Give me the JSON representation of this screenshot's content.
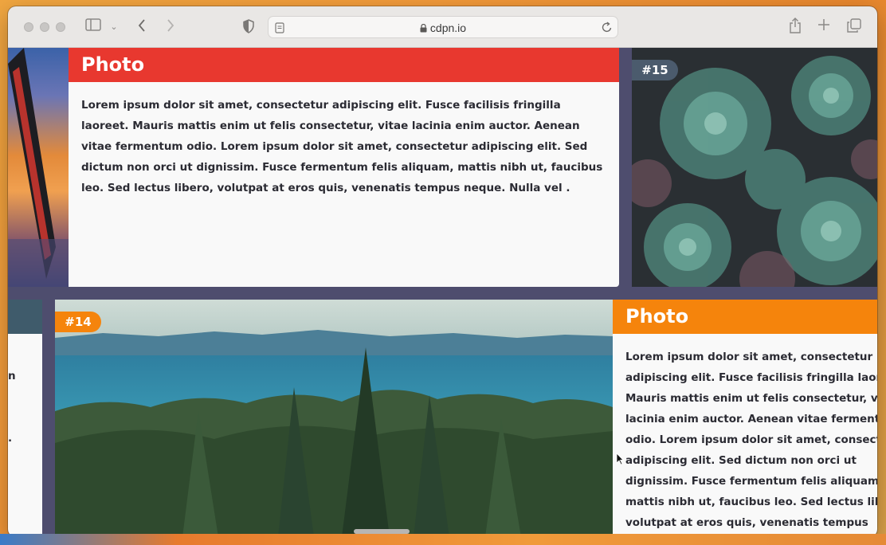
{
  "browser": {
    "address": "cdpn.io",
    "icons": {
      "sidebar": "sidebar-icon",
      "back": "chevron-left-icon",
      "forward": "chevron-right-icon",
      "shield": "shield-icon",
      "page": "page-icon",
      "lock": "lock-icon",
      "reload": "reload-icon",
      "share": "share-icon",
      "new_tab": "plus-icon",
      "tabs": "tabs-overview-icon"
    }
  },
  "cards": [
    {
      "title": "Photo",
      "header_color": "#e8382f",
      "text": "Lorem ipsum dolor sit amet, consectetur adipiscing elit. Fusce facilisis fringilla laoreet. Mauris mattis enim ut felis consectetur, vitae lacinia enim auctor. Aenean vitae fermentum odio. Lorem ipsum dolor sit amet, consectetur adipiscing elit. Sed dictum non orci ut dignissim. Fusce fermentum felis aliquam, mattis nibh ut, faucibus leo. Sed lectus libero, volutpat at eros quis, venenatis tempus neque. Nulla vel ."
    },
    {
      "title": "Photo",
      "header_color": "#f5840c",
      "text": "Lorem ipsum dolor sit amet, consectetur adipiscing elit. Fusce facilisis fringilla laoreet. Mauris mattis enim ut felis consectetur, vitae lacinia enim auctor. Aenean vitae fermentum odio. Lorem ipsum dolor sit amet, consectetur adipiscing elit. Sed dictum non orci ut dignissim. Fusce fermentum felis aliquam, mattis nibh ut, faucibus leo. Sed lectus libero, volutpat at eros quis, venenatis tempus neque. Nulla vel ."
    }
  ],
  "tags": {
    "t15": {
      "label": "#15",
      "color": "#4b5b6d"
    },
    "t14": {
      "label": "#14",
      "color": "#f5840c"
    }
  },
  "left_fragment": {
    "lines": [
      "n",
      "."
    ]
  },
  "colors": {
    "page_background": "#4e4d6e",
    "left_header_fragment": "#3f5b6b"
  }
}
